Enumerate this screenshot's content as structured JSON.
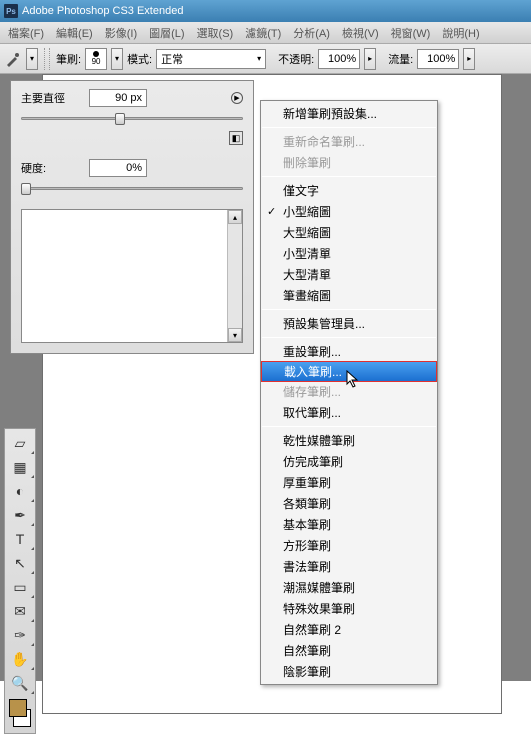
{
  "title": "Adobe Photoshop CS3 Extended",
  "ps_badge": "Ps",
  "menubar": [
    "檔案(F)",
    "編輯(E)",
    "影像(I)",
    "圖層(L)",
    "選取(S)",
    "濾鏡(T)",
    "分析(A)",
    "檢視(V)",
    "視窗(W)",
    "說明(H)"
  ],
  "options": {
    "brush_label": "筆刷:",
    "brush_size_small": "90",
    "mode_label": "模式:",
    "mode_value": "正常",
    "opacity_label": "不透明:",
    "opacity_value": "100%",
    "flow_label": "流量:",
    "flow_value": "100%"
  },
  "brush_panel": {
    "diameter_label": "主要直徑",
    "diameter_value": "90 px",
    "hardness_label": "硬度:",
    "hardness_value": "0%"
  },
  "context_menu": {
    "groups": [
      [
        {
          "label": "新增筆刷預設集...",
          "state": "normal"
        }
      ],
      [
        {
          "label": "重新命名筆刷...",
          "state": "disabled"
        },
        {
          "label": "刪除筆刷",
          "state": "disabled"
        }
      ],
      [
        {
          "label": "僅文字",
          "state": "normal"
        },
        {
          "label": "小型縮圖",
          "state": "checked"
        },
        {
          "label": "大型縮圖",
          "state": "normal"
        },
        {
          "label": "小型清單",
          "state": "normal"
        },
        {
          "label": "大型清單",
          "state": "normal"
        },
        {
          "label": "筆畫縮圖",
          "state": "normal"
        }
      ],
      [
        {
          "label": "預設集管理員...",
          "state": "normal"
        }
      ],
      [
        {
          "label": "重設筆刷...",
          "state": "normal"
        },
        {
          "label": "載入筆刷...",
          "state": "highlighted"
        },
        {
          "label": "儲存筆刷...",
          "state": "disabled"
        },
        {
          "label": "取代筆刷...",
          "state": "normal"
        }
      ],
      [
        {
          "label": "乾性媒體筆刷",
          "state": "normal"
        },
        {
          "label": "仿完成筆刷",
          "state": "normal"
        },
        {
          "label": "厚重筆刷",
          "state": "normal"
        },
        {
          "label": "各類筆刷",
          "state": "normal"
        },
        {
          "label": "基本筆刷",
          "state": "normal"
        },
        {
          "label": "方形筆刷",
          "state": "normal"
        },
        {
          "label": "書法筆刷",
          "state": "normal"
        },
        {
          "label": "潮濕媒體筆刷",
          "state": "normal"
        },
        {
          "label": "特殊效果筆刷",
          "state": "normal"
        },
        {
          "label": "自然筆刷 2",
          "state": "normal"
        },
        {
          "label": "自然筆刷",
          "state": "normal"
        },
        {
          "label": "陰影筆刷",
          "state": "normal"
        }
      ]
    ]
  },
  "tools": [
    {
      "name": "eraser-tool",
      "glyph": "▱"
    },
    {
      "name": "gradient-tool",
      "glyph": "▦"
    },
    {
      "name": "blur-tool",
      "glyph": "◐"
    },
    {
      "name": "pen-tool",
      "glyph": "✒"
    },
    {
      "name": "type-tool",
      "glyph": "T"
    },
    {
      "name": "path-select-tool",
      "glyph": "↖"
    },
    {
      "name": "shape-tool",
      "glyph": "▭"
    },
    {
      "name": "notes-tool",
      "glyph": "✉"
    },
    {
      "name": "eyedropper-tool",
      "glyph": "✑"
    },
    {
      "name": "hand-tool",
      "glyph": "✋"
    },
    {
      "name": "zoom-tool",
      "glyph": "🔍"
    }
  ],
  "swatch": {
    "fg": "#b8924a",
    "bg": "#ffffff"
  }
}
